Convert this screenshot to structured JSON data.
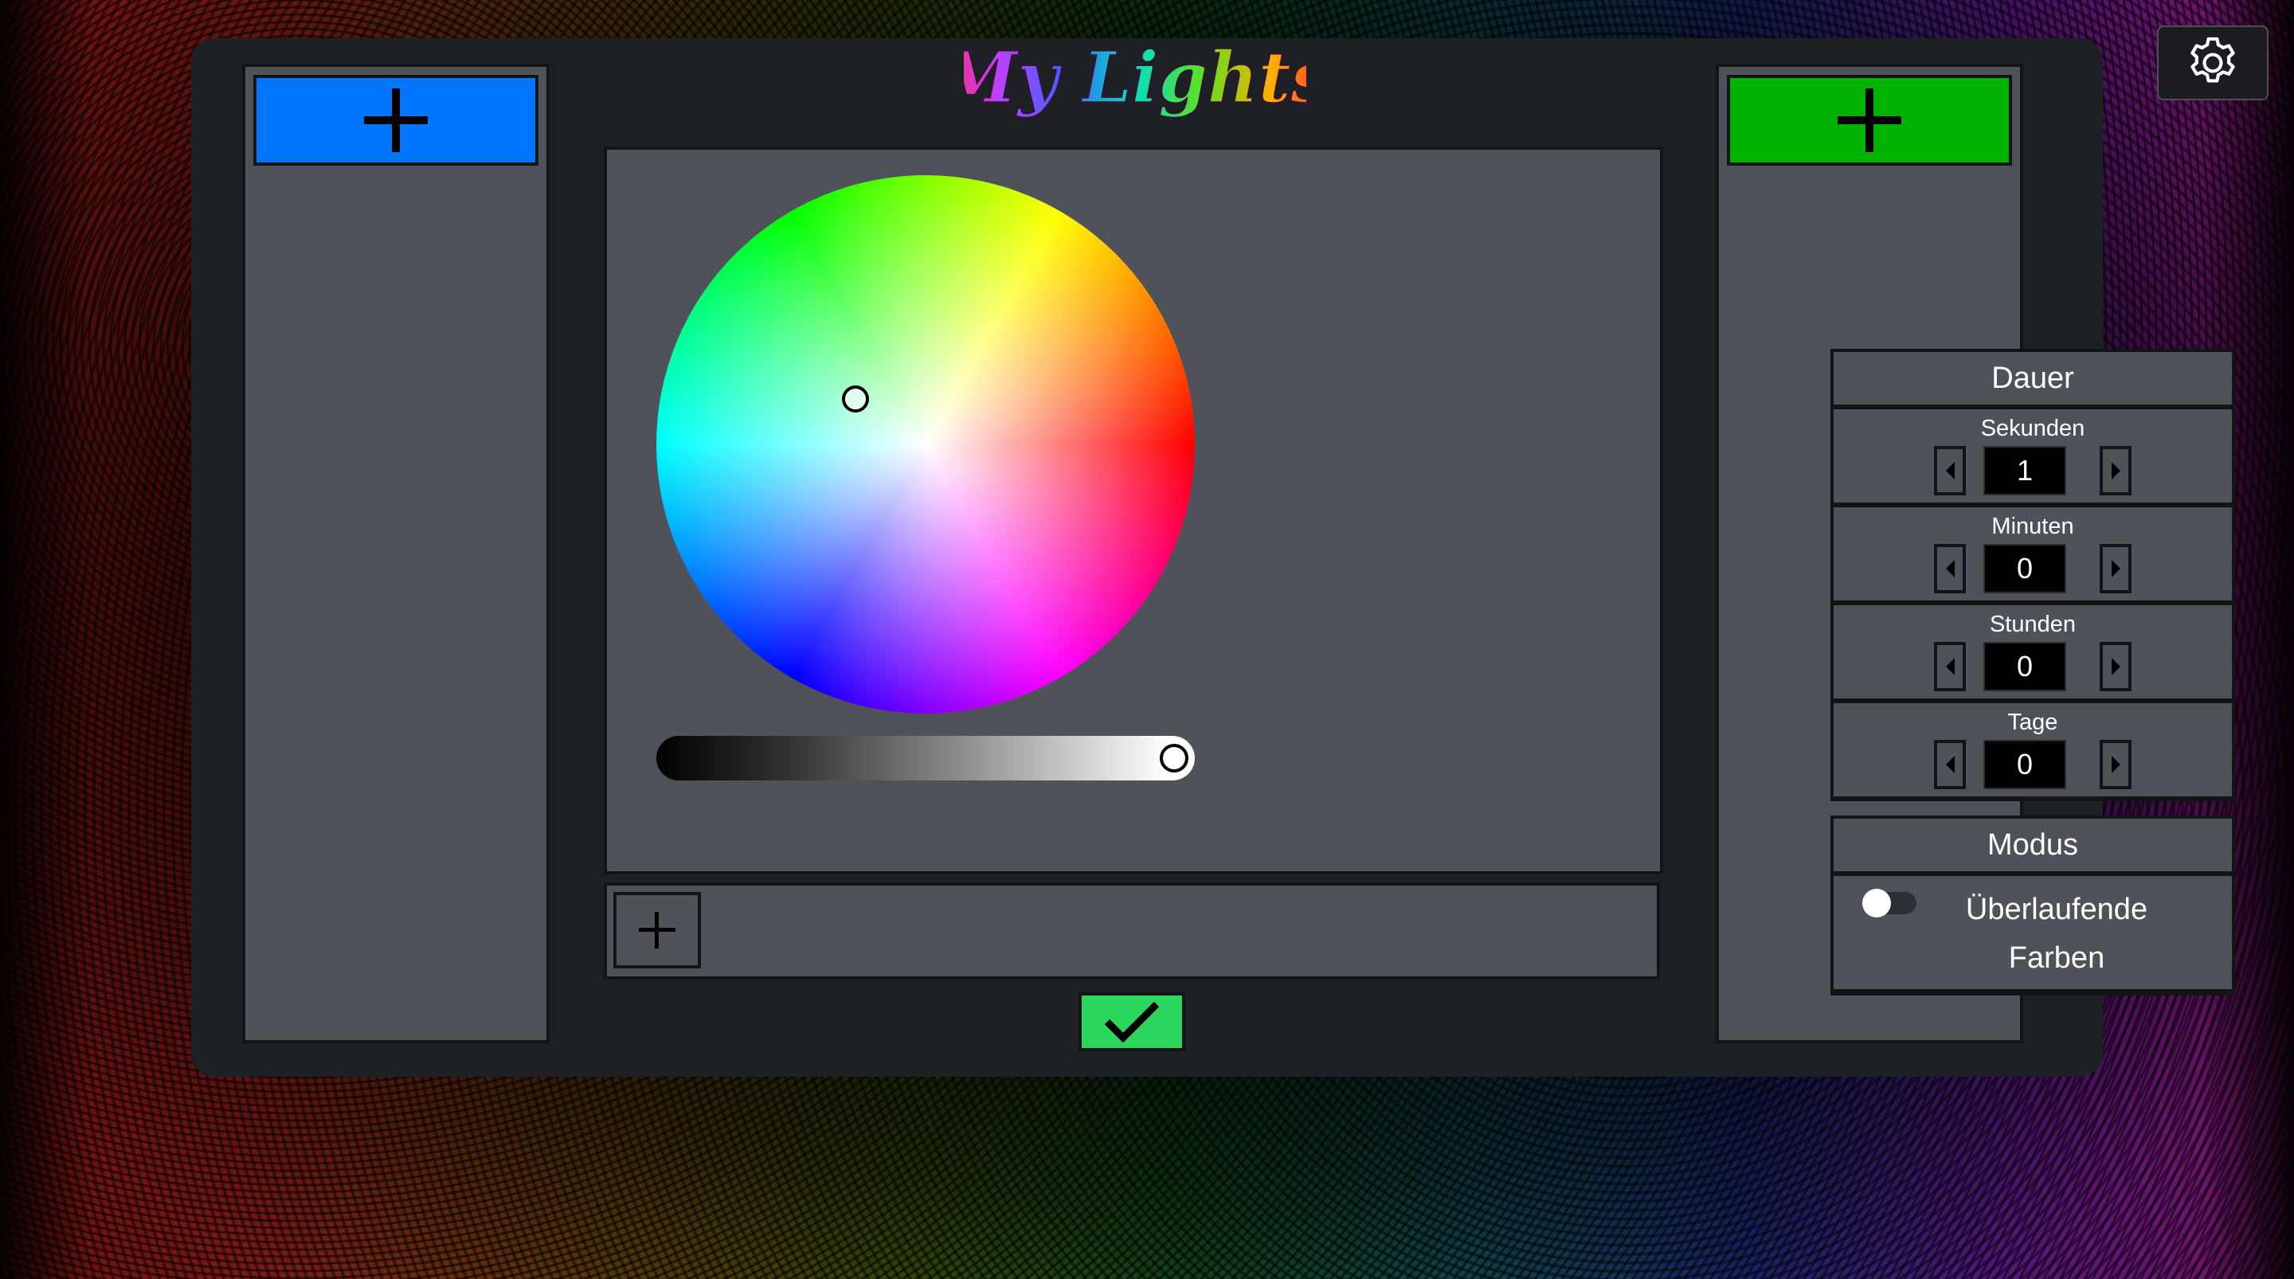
{
  "app": {
    "title": "My Lights"
  },
  "colors": {
    "left_add": "#0076ff",
    "right_add": "#00b200",
    "confirm": "#2ad65b",
    "panel": "#4f5359",
    "frame": "#1d2024"
  },
  "icons": {
    "settings": "gear-icon",
    "left_add": "plus-icon",
    "right_add": "plus-icon",
    "strip_add": "plus-icon",
    "confirm": "checkmark-icon"
  },
  "color_picker": {
    "brightness": 1.0
  },
  "dauer": {
    "title": "Dauer",
    "fields": [
      {
        "label": "Sekunden",
        "value": "1"
      },
      {
        "label": "Minuten",
        "value": "0"
      },
      {
        "label": "Stunden",
        "value": "0"
      },
      {
        "label": "Tage",
        "value": "0"
      }
    ]
  },
  "modus": {
    "title": "Modus",
    "toggle_label": "Überlaufende Farben",
    "toggle_on": false
  }
}
